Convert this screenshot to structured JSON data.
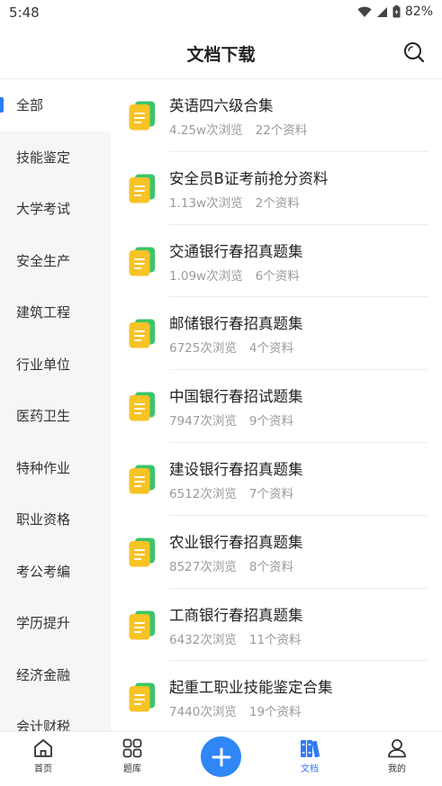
{
  "status_bar": {
    "time": "5:48",
    "battery": "82%"
  },
  "header": {
    "title": "文档下载"
  },
  "sidebar": {
    "items": [
      {
        "label": "全部",
        "active": true
      },
      {
        "label": "技能鉴定",
        "active": false
      },
      {
        "label": "大学考试",
        "active": false
      },
      {
        "label": "安全生产",
        "active": false
      },
      {
        "label": "建筑工程",
        "active": false
      },
      {
        "label": "行业单位",
        "active": false
      },
      {
        "label": "医药卫生",
        "active": false
      },
      {
        "label": "特种作业",
        "active": false
      },
      {
        "label": "职业资格",
        "active": false
      },
      {
        "label": "考公考编",
        "active": false
      },
      {
        "label": "学历提升",
        "active": false
      },
      {
        "label": "经济金融",
        "active": false
      },
      {
        "label": "会计财税",
        "active": false
      }
    ]
  },
  "docs": [
    {
      "title": "英语四六级合集",
      "views": "4.25w次浏览",
      "count": "22个资料"
    },
    {
      "title": "安全员B证考前抢分资料",
      "views": "1.13w次浏览",
      "count": "2个资料"
    },
    {
      "title": "交通银行春招真题集",
      "views": "1.09w次浏览",
      "count": "6个资料"
    },
    {
      "title": "邮储银行春招真题集",
      "views": "6725次浏览",
      "count": "4个资料"
    },
    {
      "title": "中国银行春招试题集",
      "views": "7947次浏览",
      "count": "9个资料"
    },
    {
      "title": "建设银行春招真题集",
      "views": "6512次浏览",
      "count": "7个资料"
    },
    {
      "title": "农业银行春招真题集",
      "views": "8527次浏览",
      "count": "8个资料"
    },
    {
      "title": "工商银行春招真题集",
      "views": "6432次浏览",
      "count": "11个资料"
    },
    {
      "title": "起重工职业技能鉴定合集",
      "views": "7440次浏览",
      "count": "19个资料"
    }
  ],
  "bottom_nav": {
    "home": "首页",
    "question_bank": "题库",
    "documents": "文档",
    "mine": "我的"
  },
  "colors": {
    "accent": "#2f7bf5",
    "doc_icon_yellow": "#f7c325",
    "doc_icon_green": "#3cc46a"
  }
}
